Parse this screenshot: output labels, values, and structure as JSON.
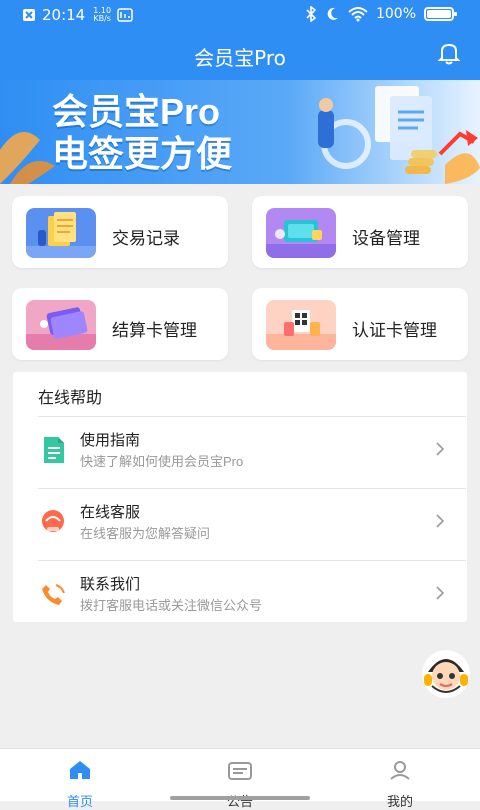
{
  "status": {
    "time": "20:14",
    "speed": "1.10",
    "speed_unit": "KB/s",
    "battery": "100%"
  },
  "header": {
    "title": "会员宝Pro"
  },
  "banner": {
    "line1": "会员宝Pro",
    "line2": "电签更方便"
  },
  "cards": [
    {
      "label": "交易记录"
    },
    {
      "label": "设备管理"
    },
    {
      "label": "结算卡管理"
    },
    {
      "label": "认证卡管理"
    }
  ],
  "help": {
    "title": "在线帮助",
    "items": [
      {
        "title": "使用指南",
        "subtitle": "快速了解如何使用会员宝Pro"
      },
      {
        "title": "在线客服",
        "subtitle": "在线客服为您解答疑问"
      },
      {
        "title": "联系我们",
        "subtitle": "拨打客服电话或关注微信公众号"
      }
    ]
  },
  "nav": [
    {
      "label": "首页"
    },
    {
      "label": "公告"
    },
    {
      "label": "我的"
    }
  ],
  "colors": {
    "accent": "#2f8ef3",
    "text": "#222222",
    "subtext": "#999999"
  }
}
